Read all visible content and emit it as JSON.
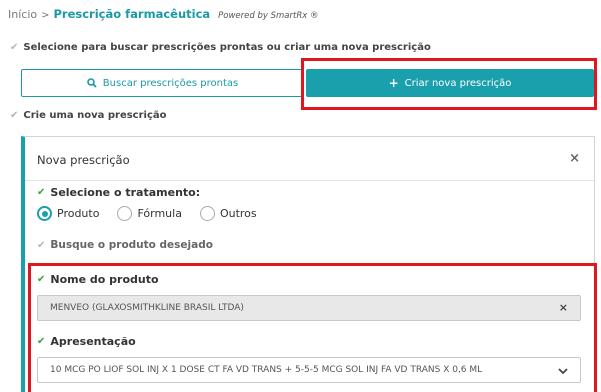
{
  "breadcrumb": {
    "home": "Início",
    "separator": ">",
    "current": "Prescrição farmacêutica",
    "powered_by": "Powered by SmartRx ®"
  },
  "step1": {
    "label": "Selecione para buscar prescrições prontas ou criar uma nova prescrição"
  },
  "actions": {
    "search_label": "Buscar prescrições prontas",
    "search_icon": "search-icon",
    "create_label": "Criar nova prescrição",
    "create_icon": "plus-icon"
  },
  "step2": {
    "label": "Crie uma nova prescrição"
  },
  "card": {
    "title": "Nova prescrição",
    "close": "×",
    "treatment": {
      "label": "Selecione o tratamento:",
      "options": [
        "Produto",
        "Fórmula",
        "Outros"
      ],
      "selected": "Produto"
    },
    "search_product": {
      "label": "Busque o produto desejado"
    },
    "product_name": {
      "label": "Nome do produto",
      "value": "MENVEO (GLAXOSMITHKLINE BRASIL LTDA)",
      "clear": "×"
    },
    "presentation": {
      "label": "Apresentação",
      "value": "10 MCG PO LIOF SOL INJ X 1 DOSE CT FA VD TRANS + 5-5-5 MCG SOL INJ FA VD TRANS X 0,6 ML"
    }
  },
  "colors": {
    "accent": "#1aa0ad",
    "highlight": "#e0171f",
    "check": "#3aa13a"
  }
}
